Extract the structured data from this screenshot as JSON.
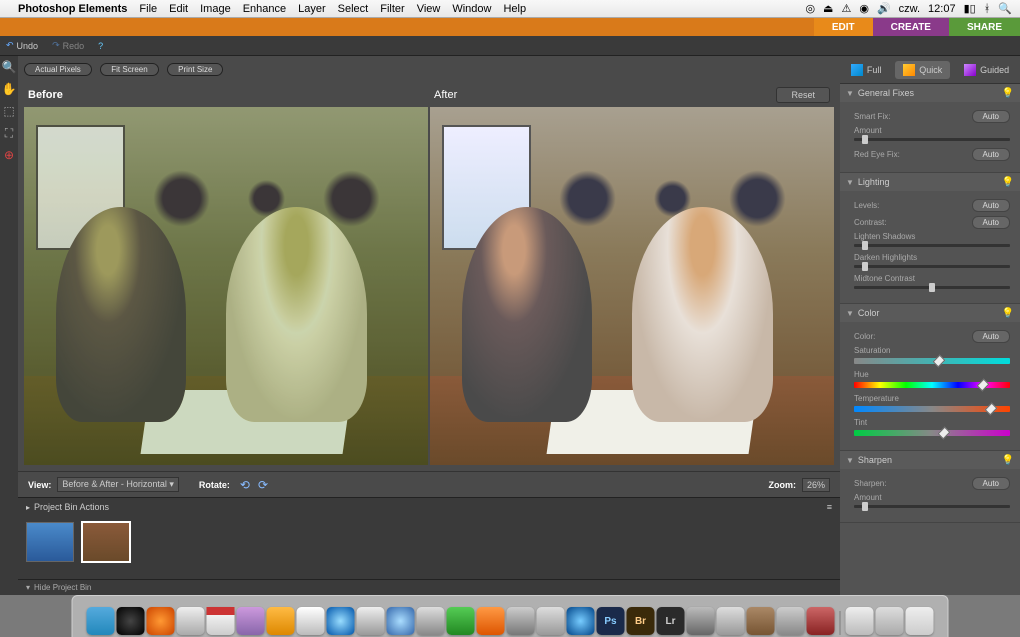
{
  "menubar": {
    "app": "Photoshop Elements",
    "items": [
      "File",
      "Edit",
      "Image",
      "Enhance",
      "Layer",
      "Select",
      "Filter",
      "View",
      "Window",
      "Help"
    ],
    "clock_day": "czw.",
    "clock_time": "12:07"
  },
  "workspace_tabs": {
    "edit": "EDIT",
    "create": "CREATE",
    "share": "SHARE"
  },
  "options_bar": {
    "undo": "Undo",
    "redo": "Redo",
    "actual_pixels": "Actual Pixels",
    "fit_screen": "Fit Screen",
    "print_size": "Print Size"
  },
  "editor": {
    "before_label": "Before",
    "after_label": "After",
    "reset": "Reset",
    "view_label": "View:",
    "view_mode": "Before & After - Horizontal",
    "rotate_label": "Rotate:",
    "zoom_label": "Zoom:",
    "zoom_value": "26%"
  },
  "project_bin": {
    "header": "Project Bin Actions",
    "hide": "Hide Project Bin"
  },
  "mode_tabs": {
    "full": "Full",
    "quick": "Quick",
    "guided": "Guided"
  },
  "panels": {
    "general": {
      "title": "General Fixes",
      "smart_fix": "Smart Fix:",
      "amount": "Amount",
      "red_eye": "Red Eye Fix:",
      "auto": "Auto"
    },
    "lighting": {
      "title": "Lighting",
      "levels": "Levels:",
      "contrast": "Contrast:",
      "lighten": "Lighten Shadows",
      "darken": "Darken Highlights",
      "midtone": "Midtone Contrast",
      "auto": "Auto"
    },
    "color": {
      "title": "Color",
      "color_label": "Color:",
      "saturation": "Saturation",
      "hue": "Hue",
      "temperature": "Temperature",
      "tint": "Tint",
      "auto": "Auto"
    },
    "sharpen": {
      "title": "Sharpen",
      "sharpen_label": "Sharpen:",
      "amount": "Amount",
      "auto": "Auto"
    }
  }
}
